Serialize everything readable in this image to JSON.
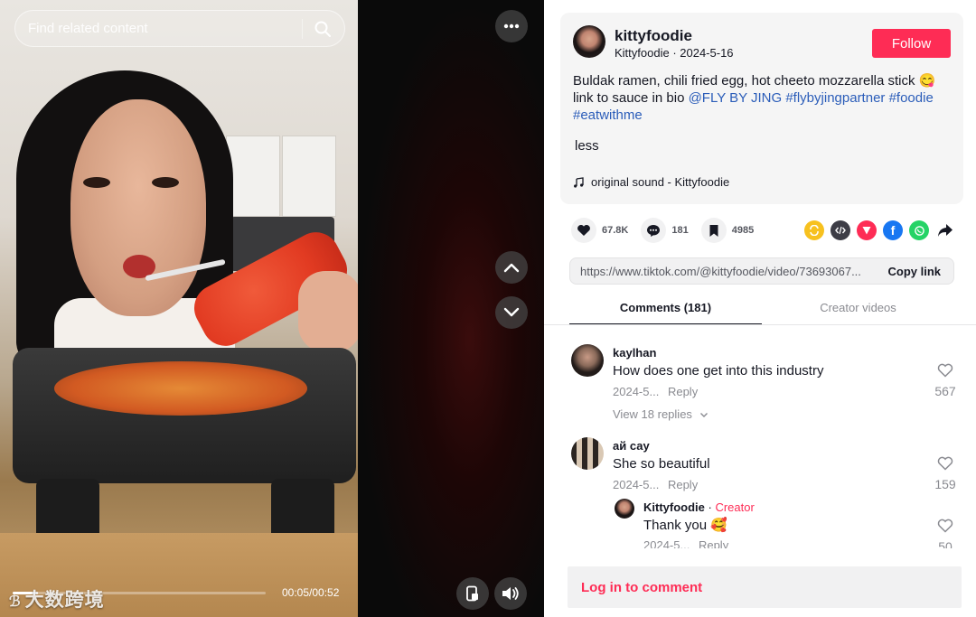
{
  "search": {
    "placeholder": "Find related content"
  },
  "video": {
    "time": "00:05/00:52",
    "progress": 0.1,
    "watermark": "大数跨境"
  },
  "author": {
    "username": "kittyfoodie",
    "display_name": "Kittyfoodie",
    "date": "2024-5-16",
    "subline": "Kittyfoodie · 2024-5-16",
    "follow_label": "Follow"
  },
  "caption": {
    "text": "Buldak ramen, chili fried egg, hot cheeto mozzarella stick 😋 link to sauce in bio",
    "tags": [
      "@FLY BY JING",
      "#flybyjingpartner",
      "#foodie",
      "#eatwithme"
    ],
    "less_label": "less"
  },
  "sound": {
    "label": "original sound - Kittyfoodie"
  },
  "stats": {
    "likes": "67.8K",
    "comments": "181",
    "saves": "4985"
  },
  "share_icons": [
    "repost-icon",
    "embed-icon",
    "send-icon",
    "facebook-icon",
    "whatsapp-icon",
    "share-arrow-icon"
  ],
  "link": {
    "url": "https://www.tiktok.com/@kittyfoodie/video/73693067...",
    "copy_label": "Copy link"
  },
  "tabs": {
    "comments": "Comments (181)",
    "creator": "Creator videos"
  },
  "comments": [
    {
      "user": "kaylhan",
      "text": "How does one get into this industry",
      "date": "2024-5...",
      "reply": "Reply",
      "likes": "567",
      "view_replies": "View 18 replies"
    },
    {
      "user": "ай сау",
      "text": "She so beautiful",
      "date": "2024-5...",
      "reply": "Reply",
      "likes": "159"
    },
    {
      "user": "Kittyfoodie",
      "creator_label": "Creator",
      "separator": " · ",
      "text": "Thank you 🥰",
      "date": "2024-5...",
      "reply": "Reply",
      "likes": "50"
    }
  ],
  "login": {
    "label": "Log in to comment"
  },
  "colors": {
    "accent": "#fe2c55",
    "tag": "#2b5db9",
    "text": "#161823",
    "muted": "#8a8b91"
  }
}
